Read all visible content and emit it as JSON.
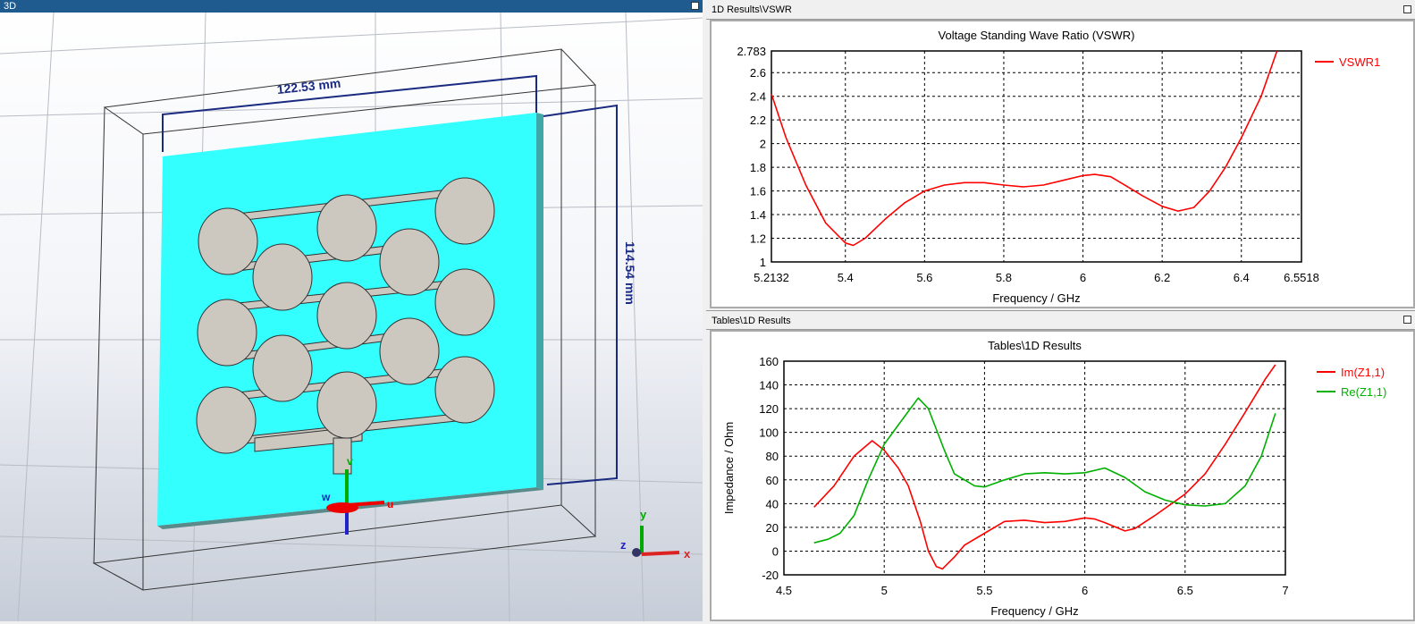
{
  "left_pane": {
    "title": "3D",
    "dim_width": "122.53 mm",
    "dim_height": "114.54 mm",
    "axes": {
      "u": "u",
      "v": "v",
      "w": "w",
      "x": "x",
      "y": "y",
      "z": "z"
    }
  },
  "vswr_pane": {
    "title": "1D Results\\VSWR"
  },
  "tables_pane": {
    "title": "Tables\\1D Results"
  },
  "chart_data": [
    {
      "type": "line",
      "title": "Voltage Standing Wave Ratio (VSWR)",
      "xlabel": "Frequency / GHz",
      "ylabel": "",
      "xlim": [
        5.2132,
        6.5518
      ],
      "ylim": [
        1,
        2.783
      ],
      "xticks": [
        "5.2132",
        "5.4",
        "5.6",
        "5.8",
        "6",
        "6.2",
        "6.4",
        "6.5518"
      ],
      "yticks": [
        "1",
        "1.2",
        "1.4",
        "1.6",
        "1.8",
        "2",
        "2.2",
        "2.4",
        "2.6",
        "2.783"
      ],
      "legend": "top-right",
      "grid": true,
      "series": [
        {
          "name": "VSWR1",
          "color": "#ff0000",
          "x": [
            5.2132,
            5.25,
            5.3,
            5.35,
            5.4,
            5.42,
            5.45,
            5.5,
            5.55,
            5.6,
            5.65,
            5.7,
            5.75,
            5.8,
            5.85,
            5.9,
            5.95,
            6.0,
            6.03,
            6.07,
            6.1,
            6.15,
            6.2,
            6.24,
            6.28,
            6.32,
            6.36,
            6.4,
            6.45,
            6.49
          ],
          "y": [
            2.42,
            2.05,
            1.65,
            1.33,
            1.16,
            1.14,
            1.2,
            1.36,
            1.5,
            1.6,
            1.65,
            1.67,
            1.67,
            1.65,
            1.635,
            1.65,
            1.69,
            1.73,
            1.74,
            1.72,
            1.66,
            1.56,
            1.47,
            1.43,
            1.46,
            1.6,
            1.8,
            2.05,
            2.4,
            2.783
          ]
        }
      ]
    },
    {
      "type": "line",
      "title": "Tables\\1D Results",
      "xlabel": "Frequency / GHz",
      "ylabel": "Impedance  / Ohm",
      "xlim": [
        4.5,
        7
      ],
      "ylim": [
        -20,
        160
      ],
      "xticks": [
        "4.5",
        "5",
        "5.5",
        "6",
        "6.5",
        "7"
      ],
      "yticks": [
        "-20",
        "0",
        "20",
        "40",
        "60",
        "80",
        "100",
        "120",
        "140",
        "160"
      ],
      "legend": "top-right",
      "grid": true,
      "series": [
        {
          "name": "Im(Z1,1)",
          "color": "#ff0000",
          "x": [
            4.65,
            4.75,
            4.85,
            4.94,
            5.0,
            5.07,
            5.12,
            5.18,
            5.22,
            5.26,
            5.29,
            5.35,
            5.4,
            5.5,
            5.6,
            5.7,
            5.8,
            5.9,
            6.0,
            6.05,
            6.1,
            6.2,
            6.25,
            6.35,
            6.5,
            6.6,
            6.7,
            6.8,
            6.9,
            6.95
          ],
          "y": [
            37,
            55,
            80,
            93,
            85,
            70,
            55,
            25,
            0,
            -13,
            -15,
            -5,
            5,
            15,
            25,
            26,
            24,
            25,
            28,
            27,
            24,
            17,
            19,
            30,
            48,
            65,
            90,
            117,
            145,
            157
          ]
        },
        {
          "name": "Re(Z1,1)",
          "color": "#00b000",
          "x": [
            4.65,
            4.72,
            4.78,
            4.85,
            4.92,
            5.0,
            5.1,
            5.17,
            5.22,
            5.3,
            5.35,
            5.45,
            5.5,
            5.6,
            5.7,
            5.8,
            5.9,
            6.0,
            6.1,
            6.2,
            6.3,
            6.4,
            6.5,
            6.6,
            6.7,
            6.8,
            6.88,
            6.95
          ],
          "y": [
            7,
            10,
            15,
            30,
            60,
            90,
            113,
            129,
            120,
            85,
            65,
            55,
            54,
            60,
            65,
            66,
            65,
            66,
            70,
            62,
            50,
            43,
            39,
            38,
            40,
            55,
            80,
            116
          ]
        }
      ]
    }
  ]
}
